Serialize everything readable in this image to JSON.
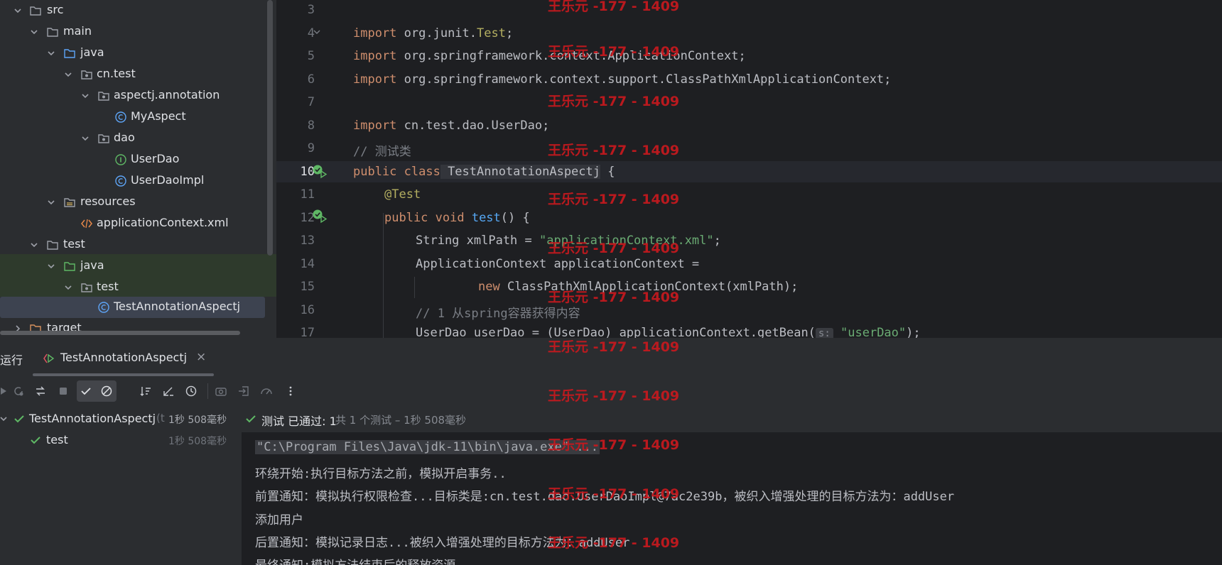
{
  "tree": {
    "items": [
      {
        "label": "src",
        "icon": "folder-icon"
      },
      {
        "label": "main",
        "icon": "folder-icon"
      },
      {
        "label": "java",
        "icon": "source-folder-icon"
      },
      {
        "label": "cn.test",
        "icon": "package-icon"
      },
      {
        "label": "aspectj.annotation",
        "icon": "package-icon"
      },
      {
        "label": "MyAspect",
        "icon": "class-icon"
      },
      {
        "label": "dao",
        "icon": "package-icon"
      },
      {
        "label": "UserDao",
        "icon": "interface-icon"
      },
      {
        "label": "UserDaoImpl",
        "icon": "class-icon"
      },
      {
        "label": "resources",
        "icon": "resources-folder-icon"
      },
      {
        "label": "applicationContext.xml",
        "icon": "xml-file-icon"
      },
      {
        "label": "test",
        "icon": "folder-icon"
      },
      {
        "label": "java",
        "icon": "test-source-folder-icon"
      },
      {
        "label": "test",
        "icon": "package-icon"
      },
      {
        "label": "TestAnnotationAspectj",
        "icon": "class-icon"
      },
      {
        "label": "target",
        "icon": "folder-icon"
      }
    ]
  },
  "editor": {
    "line_numbers": [
      "3",
      "4",
      "5",
      "6",
      "7",
      "8",
      "9",
      "10",
      "11",
      "12",
      "13",
      "14",
      "15",
      "16",
      "17"
    ],
    "lines": {
      "l4_kw": "import",
      "l4_rest": " org.junit.",
      "l4_cls": "Test",
      "l4_end": ";",
      "l5_kw": "import",
      "l5_rest": " org.springframework.context.ApplicationContext;",
      "l6_kw": "import",
      "l6_rest": " org.springframework.context.support.ClassPathXmlApplicationContext;",
      "l8_kw": "import",
      "l8_rest": " cn.test.dao.UserDao;",
      "l9_cmt": "// 测试类",
      "l10_kw": "public class",
      "l10_name": " TestAnnotationAspectj",
      "l10_end": " {",
      "l11_ann": "@Test",
      "l12_kw": "public void",
      "l12_fn": " test",
      "l12_end": "() {",
      "l13_a": "String xmlPath = ",
      "l13_str": "\"applicationContext.xml\"",
      "l13_end": ";",
      "l14": "ApplicationContext applicationContext =",
      "l15_kw": "new",
      "l15_rest": " ClassPathXmlApplicationContext(xmlPath);",
      "l16_cmt": "// 1 从spring容器获得内容",
      "l17_a": "UserDao userDao = (UserDao) applicationContext.getBean(",
      "l17_hint": "s:",
      "l17_str": " \"userDao\"",
      "l17_end": ");"
    }
  },
  "run": {
    "tab_prefix": "运行",
    "tab_label": "TestAnnotationAspectj",
    "status_passed": "测试 已通过: 1",
    "status_total": "共 1 个测试 – 1秒 508毫秒",
    "tests": [
      {
        "name": "TestAnnotationAspectj",
        "suffix": " (t",
        "time": "1秒 508毫秒"
      },
      {
        "name": "test",
        "time": "1秒 508毫秒"
      }
    ],
    "console": [
      "\"C:\\Program Files\\Java\\jdk-11\\bin\\java.exe\" ...",
      "环绕开始:执行目标方法之前，模拟开启事务..",
      "前置通知：模拟执行权限检查...目标类是:cn.test.dao.UserDaoImpl@7ac2e39b，被织入增强处理的目标方法为：addUser",
      "添加用户",
      "后置通知：模拟记录日志...被织入增强处理的目标方法为：addUser",
      "最终通知:模拟方法结束后的释放资源"
    ]
  },
  "watermark": "王乐元 -177 - 1409",
  "colors": {
    "accent": "#5ea5f7",
    "pass": "#5fb865",
    "watermark": "#c8191e"
  }
}
